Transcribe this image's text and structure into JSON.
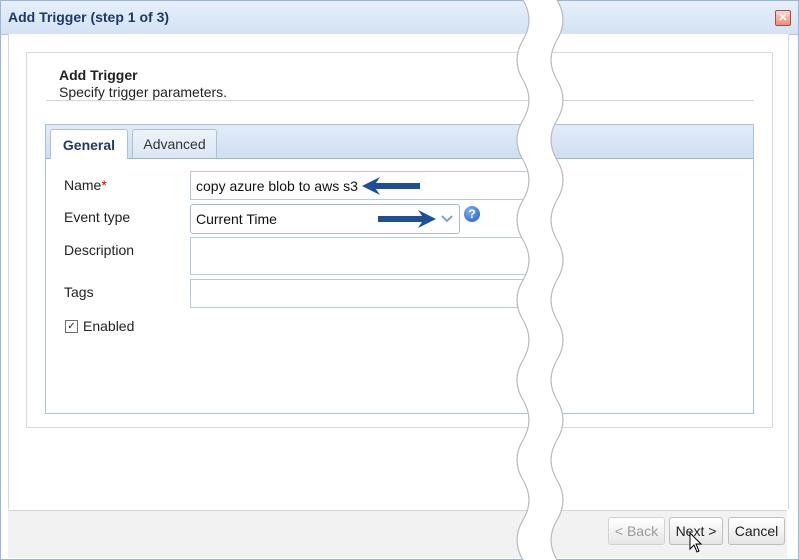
{
  "window": {
    "title": "Add Trigger (step 1 of 3)",
    "close_icon": "close-icon"
  },
  "header": {
    "title": "Add Trigger",
    "subtitle": "Specify trigger parameters."
  },
  "tabs": [
    {
      "label": "General",
      "selected": true
    },
    {
      "label": "Advanced",
      "selected": false
    }
  ],
  "form": {
    "name": {
      "label": "Name",
      "required_mark": "*",
      "value": "copy azure blob to aws s3"
    },
    "event_type": {
      "label": "Event type",
      "value": "Current Time"
    },
    "description": {
      "label": "Description",
      "value": ""
    },
    "tags": {
      "label": "Tags",
      "value": ""
    },
    "enabled": {
      "label": "Enabled",
      "checked": true
    }
  },
  "help_icon": {
    "glyph": "?"
  },
  "footer": {
    "back_label": "< Back",
    "next_label": "Next >",
    "cancel_label": "Cancel"
  },
  "colors": {
    "accent": "#1c3a66",
    "annotation_arrow": "#1f4e99",
    "tab_strip": "#d6e3f3"
  }
}
